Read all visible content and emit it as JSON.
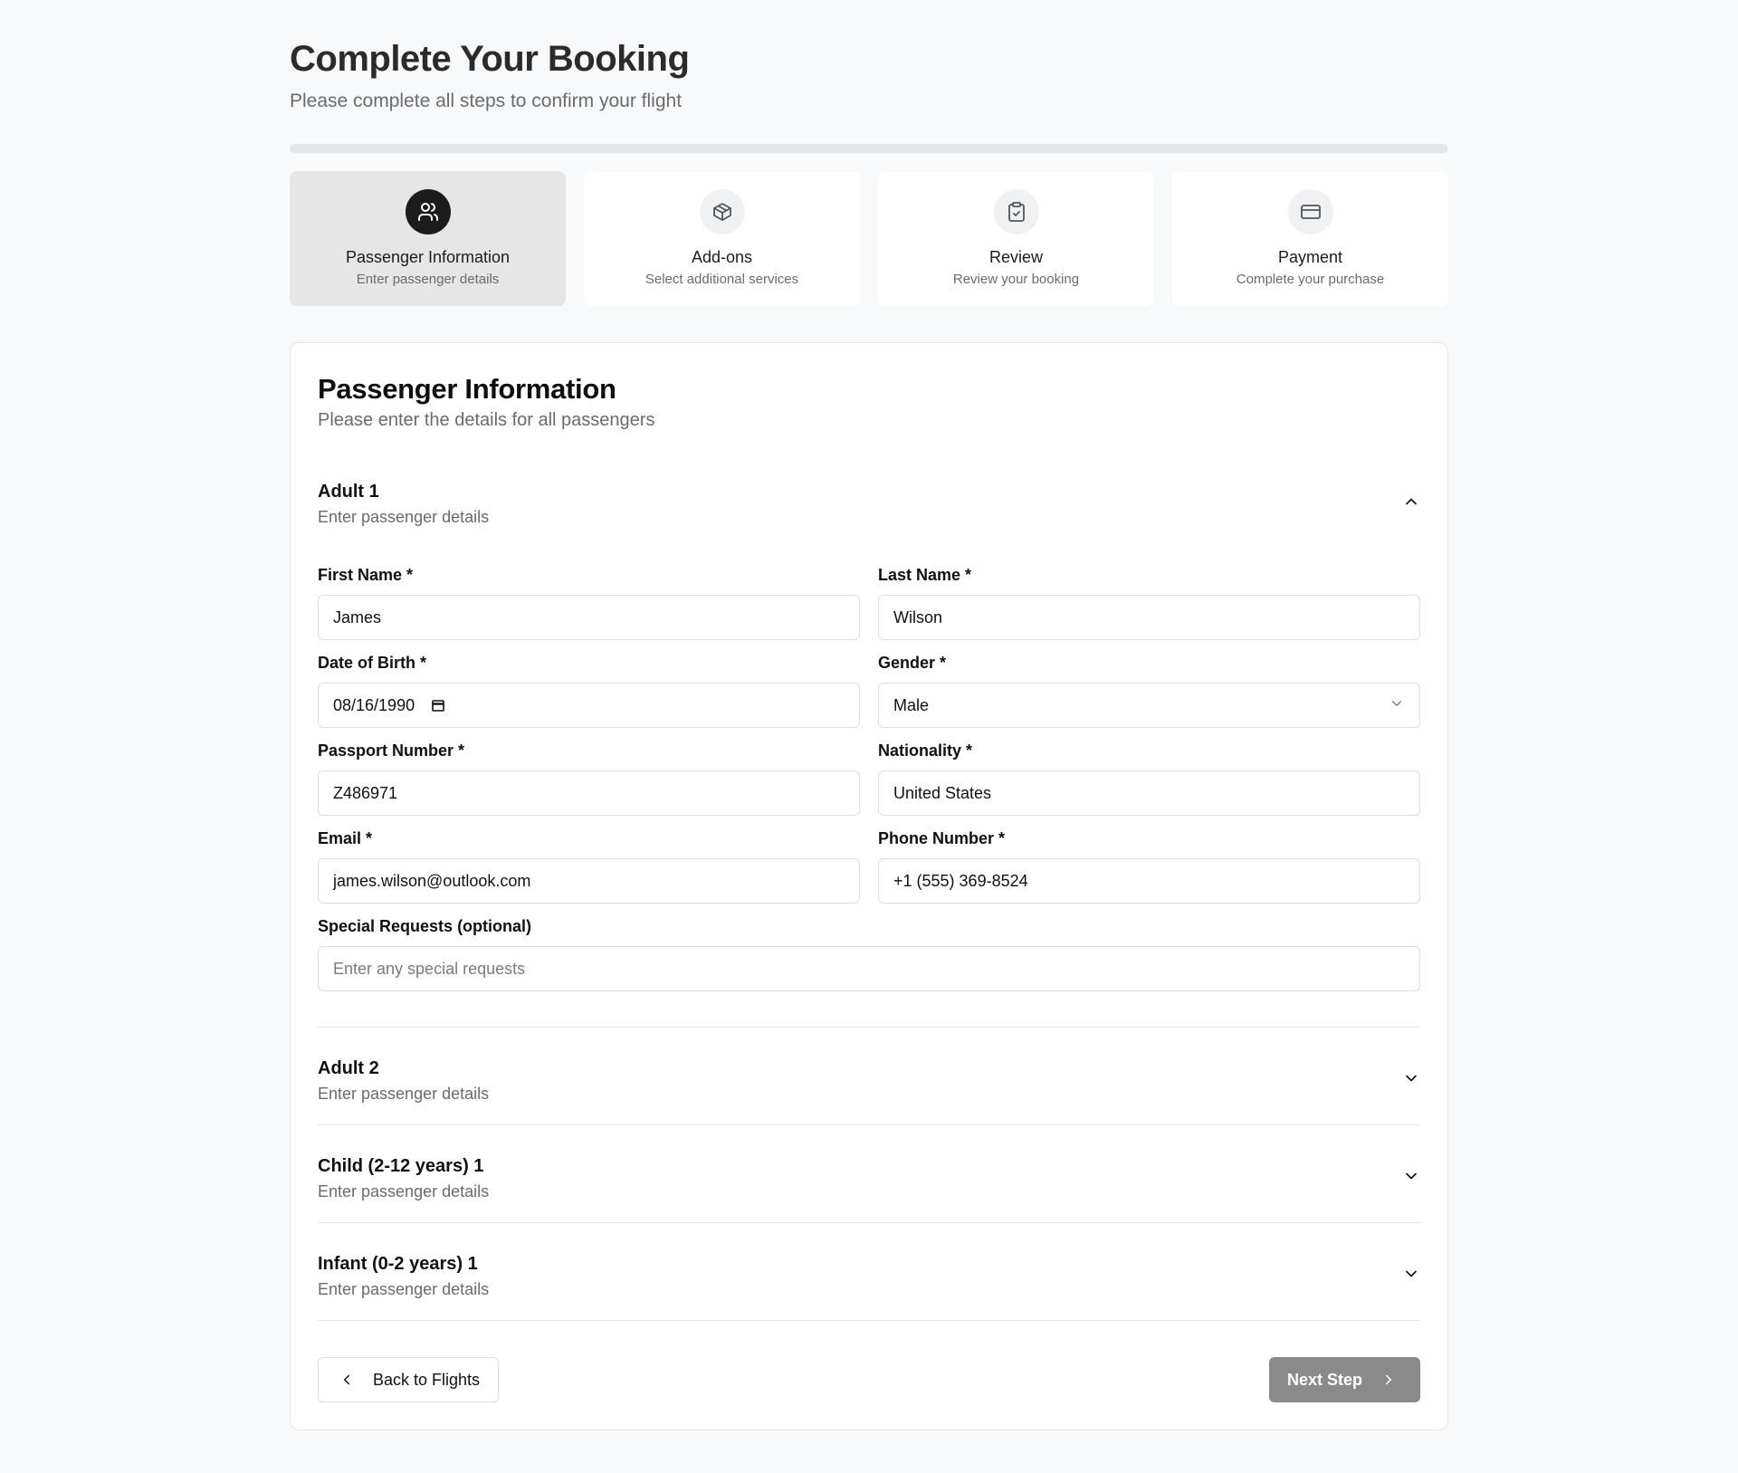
{
  "header": {
    "title": "Complete Your Booking",
    "subtitle": "Please complete all steps to confirm your flight"
  },
  "progress": {
    "fraction": 0
  },
  "steps": [
    {
      "title": "Passenger Information",
      "desc": "Enter passenger details",
      "icon": "users-icon",
      "active": true
    },
    {
      "title": "Add-ons",
      "desc": "Select additional services",
      "icon": "package-icon",
      "active": false
    },
    {
      "title": "Review",
      "desc": "Review your booking",
      "icon": "clipboard-check-icon",
      "active": false
    },
    {
      "title": "Payment",
      "desc": "Complete your purchase",
      "icon": "credit-card-icon",
      "active": false
    }
  ],
  "card": {
    "title": "Passenger Information",
    "subtitle": "Please enter the details for all passengers"
  },
  "passengers": [
    {
      "name": "Adult 1",
      "desc": "Enter passenger details",
      "expanded": true
    },
    {
      "name": "Adult 2",
      "desc": "Enter passenger details",
      "expanded": false
    },
    {
      "name": "Child (2-12 years) 1",
      "desc": "Enter passenger details",
      "expanded": false
    },
    {
      "name": "Infant (0-2 years) 1",
      "desc": "Enter passenger details",
      "expanded": false
    }
  ],
  "form": {
    "first_name": {
      "label": "First Name *",
      "value": "James"
    },
    "last_name": {
      "label": "Last Name *",
      "value": "Wilson"
    },
    "dob": {
      "label": "Date of Birth *",
      "value": "08/16/1990"
    },
    "gender": {
      "label": "Gender *",
      "value": "Male"
    },
    "passport": {
      "label": "Passport Number *",
      "value": "Z486971"
    },
    "nationality": {
      "label": "Nationality *",
      "value": "United States"
    },
    "email": {
      "label": "Email *",
      "value": "james.wilson@outlook.com"
    },
    "phone": {
      "label": "Phone Number *",
      "value": "+1 (555) 369-8524"
    },
    "special": {
      "label": "Special Requests (optional)",
      "placeholder": "Enter any special requests"
    }
  },
  "actions": {
    "back": "Back to Flights",
    "next": "Next Step"
  },
  "colors": {
    "active_step_bg": "#e6e6e6",
    "active_icon_bg": "#1c1c1c",
    "next_button_bg": "#8a8a8a",
    "page_bg": "#f8f9fb"
  }
}
